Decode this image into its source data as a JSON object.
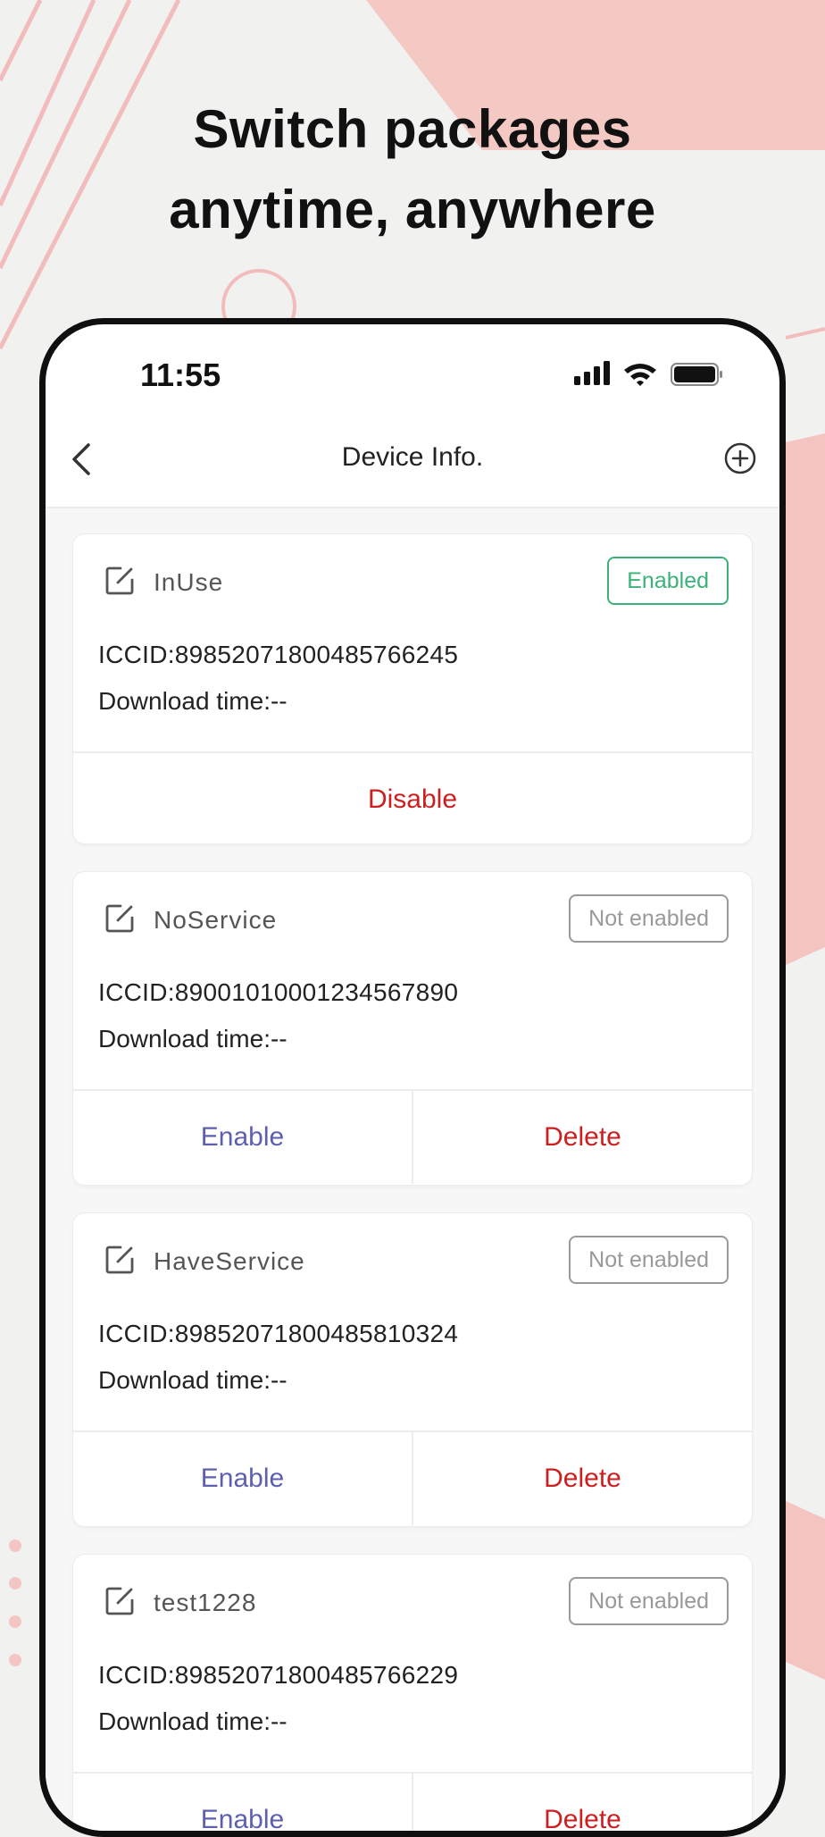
{
  "headline": {
    "line1": "Switch packages",
    "line2": "anytime, anywhere"
  },
  "status_bar": {
    "time": "11:55",
    "icons": [
      "cellular-signal-icon",
      "wifi-icon",
      "battery-icon"
    ]
  },
  "nav": {
    "title": "Device Info.",
    "back_icon": "chevron-left-icon",
    "add_icon": "plus-circle-icon"
  },
  "colors": {
    "enabled_green": "#3bb27a",
    "action_red": "#cc1f1f",
    "action_blue": "#5d5fb0",
    "accent_pink": "#f4c4c0"
  },
  "cards": [
    {
      "name": "InUse",
      "status": "Enabled",
      "iccid": "ICCID:89852071800485766245",
      "download_time": "Download time:--",
      "actions": [
        "Disable"
      ]
    },
    {
      "name": "NoService",
      "status": "Not enabled",
      "iccid": "ICCID:89001010001234567890",
      "download_time": "Download time:--",
      "actions": [
        "Enable",
        "Delete"
      ]
    },
    {
      "name": "HaveService",
      "status": "Not enabled",
      "iccid": "ICCID:89852071800485810324",
      "download_time": "Download time:--",
      "actions": [
        "Enable",
        "Delete"
      ]
    },
    {
      "name": "test1228",
      "status": "Not enabled",
      "iccid": "ICCID:89852071800485766229",
      "download_time": "Download time:--",
      "actions": [
        "Enable",
        "Delete"
      ]
    }
  ]
}
